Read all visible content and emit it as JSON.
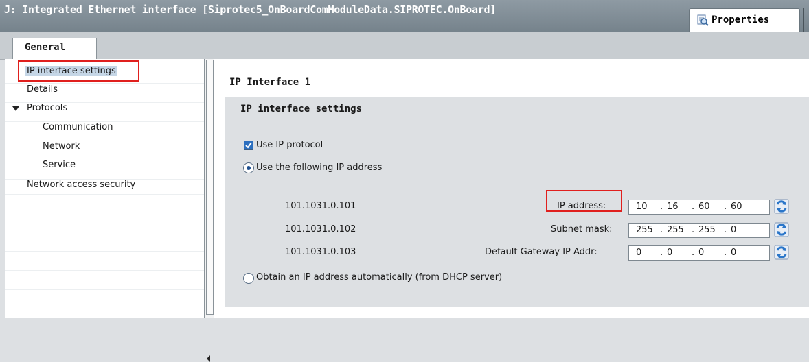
{
  "window": {
    "title": "J: Integrated Ethernet interface [Siprotec5_OnBoardComModuleData.SIPROTEC.OnBoard]",
    "properties_tab": "Properties",
    "properties_icon": "magnifier-icon"
  },
  "tabs": {
    "general": "General"
  },
  "nav": {
    "items": [
      {
        "label": "IP interface settings",
        "selected": true
      },
      {
        "label": "Details"
      },
      {
        "label": "Protocols",
        "expanded": true
      },
      {
        "label": "Communication"
      },
      {
        "label": "Network"
      },
      {
        "label": "Service"
      },
      {
        "label": "Network access security"
      }
    ]
  },
  "main": {
    "section_title": "IP Interface 1",
    "group_title": "IP interface settings",
    "use_ip_protocol": {
      "label": "Use IP protocol",
      "checked": true
    },
    "use_following_ip": {
      "label": "Use the following IP address",
      "selected": true
    },
    "obtain_dhcp": {
      "label": "Obtain an IP address automatically (from DHCP server)",
      "selected": false
    },
    "fields": [
      {
        "id": "101.1031.0.101",
        "label": "IP address:",
        "octets": [
          "10",
          "16",
          "60",
          "60"
        ]
      },
      {
        "id": "101.1031.0.102",
        "label": "Subnet mask:",
        "octets": [
          "255",
          "255",
          "255",
          "0"
        ]
      },
      {
        "id": "101.1031.0.103",
        "label": "Default Gateway IP Addr:",
        "octets": [
          "0",
          "0",
          "0",
          "0"
        ]
      }
    ],
    "dot": "."
  },
  "colors": {
    "highlight": "#e0201e",
    "accent": "#2c6fbf"
  }
}
